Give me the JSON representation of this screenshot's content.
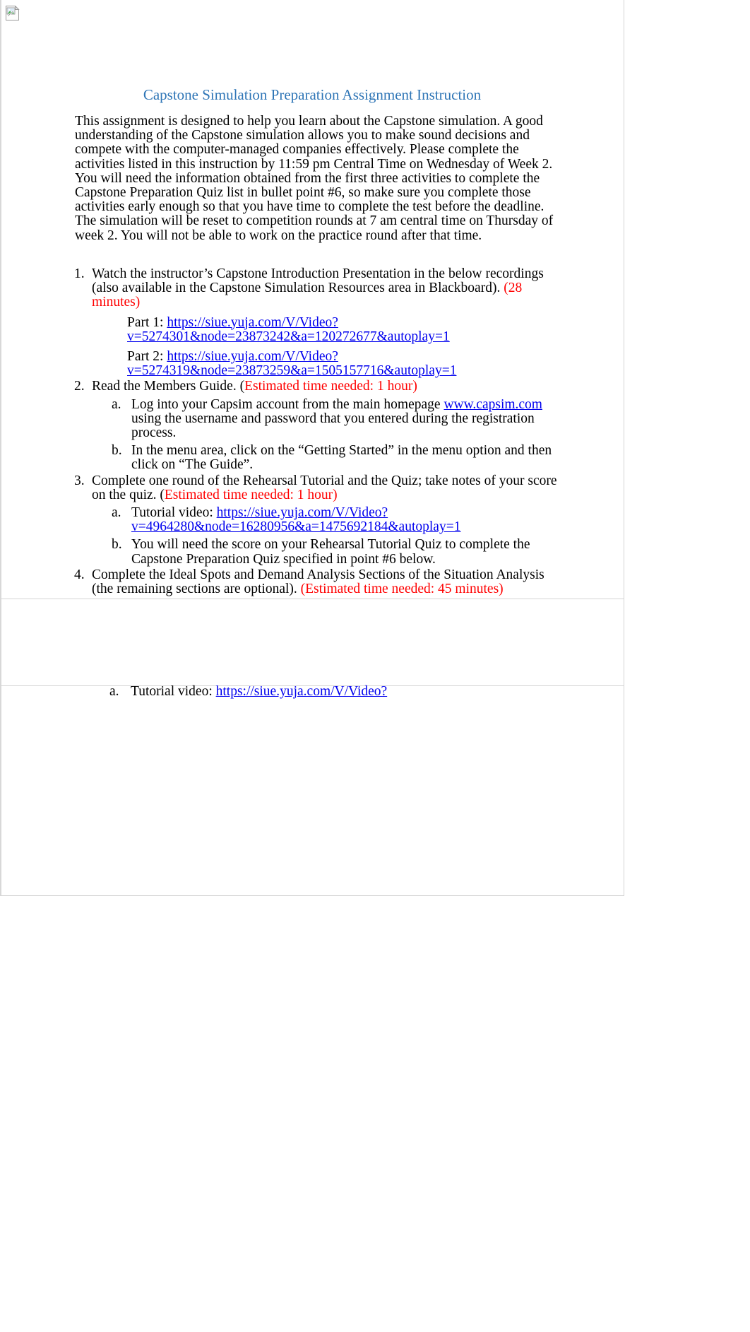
{
  "document": {
    "title": "Capstone Simulation Preparation Assignment Instruction",
    "title_color": "#2e75b6",
    "link_color": "#0000ee",
    "emphasis_color": "#ff0000",
    "broken_image_alt": ""
  },
  "intro": {
    "paragraph_1": "This assignment is designed to help you learn about the Capstone simulation. A good understanding of the Capstone simulation allows you to make sound decisions and compete with the computer-managed companies effectively. Please complete the activities listed in this instruction by 11:59 pm Central Time on Wednesday of Week 2.  You will need the information obtained from the first three activities to complete the Capstone Preparation Quiz list in bullet point #6, so make sure you complete those activities early enough so that you have time to complete the test before the deadline.",
    "paragraph_2": "The simulation will be reset to competition rounds at 7 am central time on Thursday of week 2. You will not be able to work on the practice round after that time."
  },
  "list": {
    "item1": {
      "marker": "1.",
      "text_before": "Watch the instructor’s Capstone Introduction Presentation in the below recordings  (also available in the Capstone Simulation Resources area in Blackboard). ",
      "time_estimate": "(28 minutes)",
      "sub": [
        {
          "label": "Part 1:",
          "url_line1": "https://siue.yuja.com/V/Video?",
          "url_line2": "v=5274301&node=23873242&a=120272677&autoplay=1"
        },
        {
          "label": "Part 2:",
          "url_line1": "https://siue.yuja.com/V/Video?",
          "url_line2": "v=5274319&node=23873259&a=1505157716&autoplay=1"
        }
      ]
    },
    "item2": {
      "marker": "2.",
      "text_before": "Read the Members Guide. (",
      "time_estimate": "Estimated time needed:   1 hour)",
      "sub": [
        {
          "marker": "a.",
          "text_before": "Log into your Capsim account from the main homepage ",
          "link": "www.capsim.com",
          "text_after": " using the username and password that you entered during the registration process."
        },
        {
          "marker": "b.",
          "text_before": " In the menu area, click on the “Getting Started” in the menu option and then click on “The Guide”.",
          "link": "",
          "text_after": ""
        }
      ]
    },
    "item3": {
      "marker": "3.",
      "text_before": "Complete one round of the Rehearsal Tutorial and the Quiz; take notes of your score on the quiz. (",
      "time_estimate": "Estimated time needed:   1 hour)",
      "sub": [
        {
          "marker": "a.",
          "label": "Tutorial video: ",
          "url_line1": "https://siue.yuja.com/V/Video?",
          "url_line2": "v=4964280&node=16280956&a=1475692184&autoplay=1"
        },
        {
          "marker": "b.",
          "label": "You will need the score on your Rehearsal Tutorial Quiz to complete the Capstone Preparation Quiz specified in point #6 below.",
          "url_line1": "",
          "url_line2": ""
        }
      ]
    },
    "item4": {
      "marker": "4.",
      "text_before": "Complete the Ideal Spots and Demand Analysis Sections of the Situation Analysis (the remaining sections are optional). ",
      "time_estimate": "(Estimated time needed: 45 minutes)"
    },
    "tail": {
      "marker": "a.",
      "label": "Tutorial video:  ",
      "url": "https://siue.yuja.com/V/Video?"
    }
  }
}
